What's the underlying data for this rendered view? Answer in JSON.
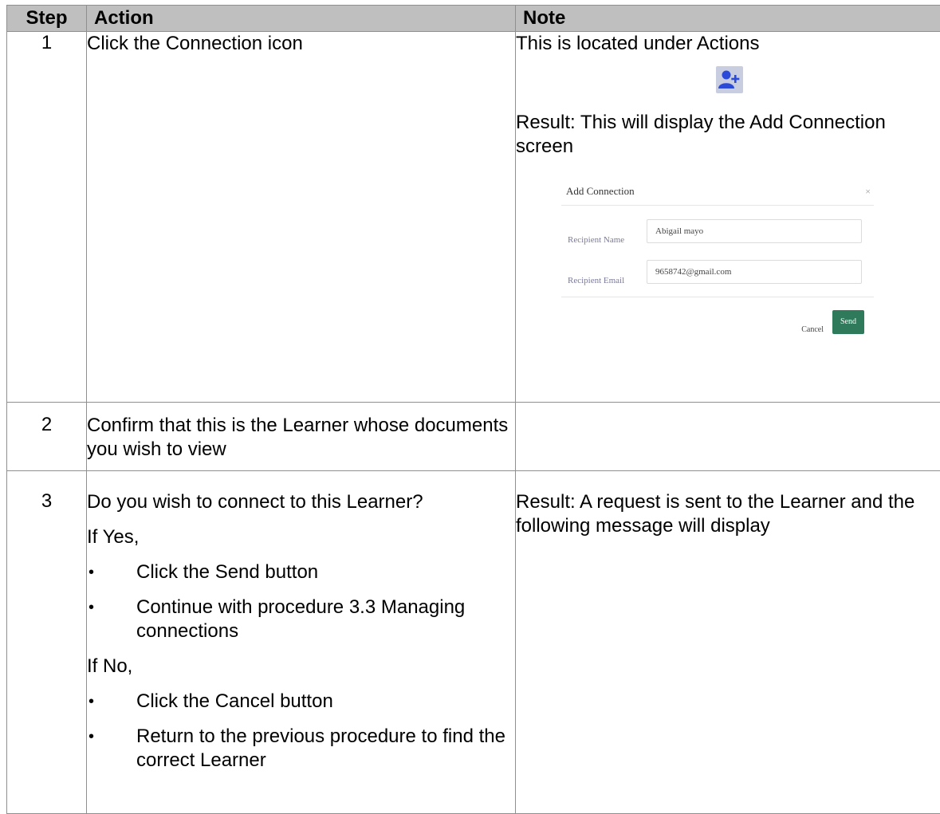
{
  "headers": {
    "step": "Step",
    "action": "Action",
    "note": "Note"
  },
  "rows": [
    {
      "step": "1",
      "action": "Click the Connection icon",
      "note_line1": "This is located under Actions",
      "note_result": "Result: This will display the Add Connection screen",
      "icon": "add-user-icon",
      "dialog": {
        "title": "Add Connection",
        "close": "×",
        "name_label": "Recipient Name",
        "name_value": "Abigail mayo",
        "email_label": "Recipient Email",
        "email_value": "9658742@gmail.com",
        "cancel": "Cancel",
        "send": "Send",
        "send_color": "#2f7a5a"
      }
    },
    {
      "step": "2",
      "action": "Confirm that this is the Learner whose documents you wish to view"
    },
    {
      "step": "3",
      "action_q": "Do you wish to connect to this Learner?",
      "if_yes": "If Yes,",
      "yes_items": [
        "Click the Send button",
        "Continue with procedure 3.3 Managing connections"
      ],
      "if_no": "If No,",
      "no_items": [
        "Click the Cancel button",
        "Return to the previous procedure to find the correct Learner"
      ],
      "note": "Result: A request is sent to the Learner and the following message will display"
    }
  ],
  "bullet_char": "•"
}
